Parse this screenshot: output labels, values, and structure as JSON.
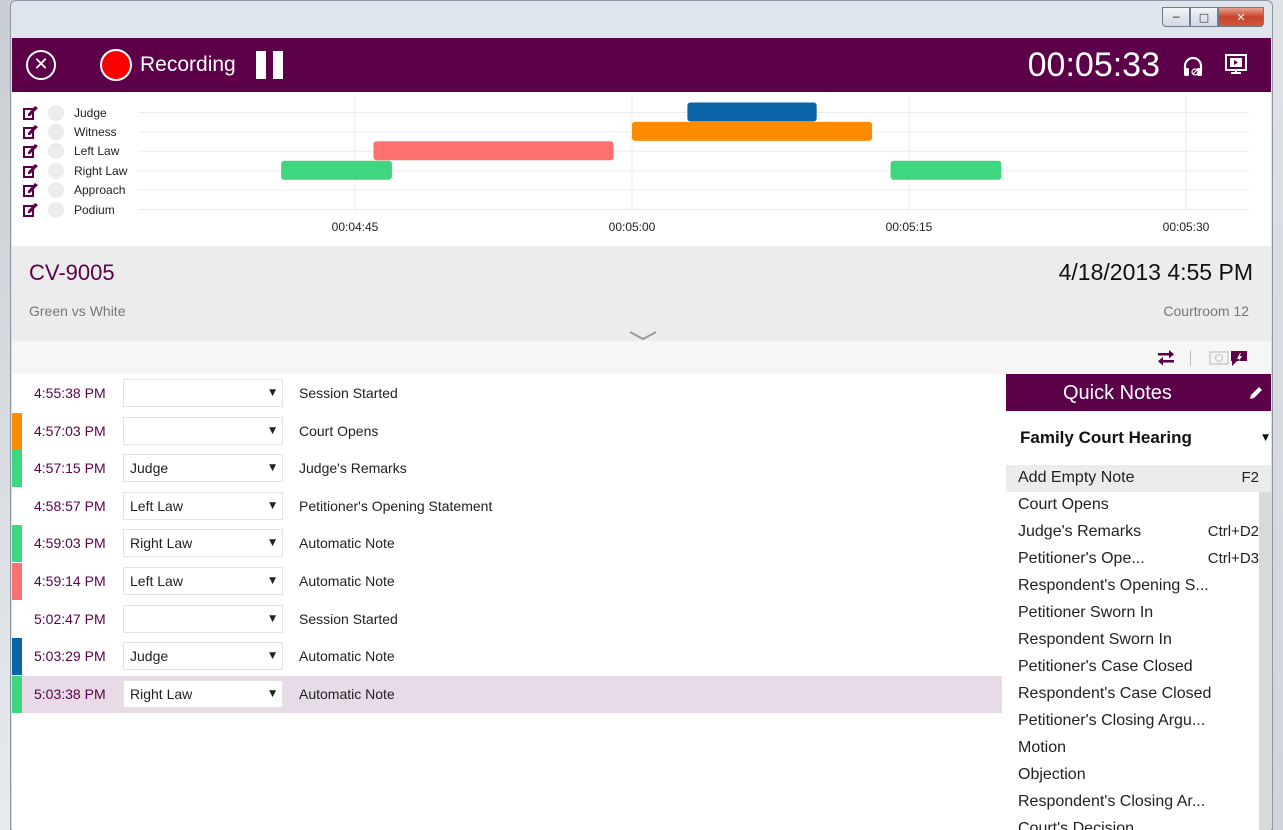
{
  "window": {
    "controls": {
      "minimize": "─",
      "maximize": "□",
      "close": "✕"
    }
  },
  "topbar": {
    "close_icon": "close-circle-icon",
    "recording_label": "Recording",
    "timer": "00:05:33",
    "colors": {
      "bar": "#5b0049",
      "record": "#ff0000"
    }
  },
  "timeline": {
    "tracks": [
      {
        "label": "Judge"
      },
      {
        "label": "Witness"
      },
      {
        "label": "Left Law"
      },
      {
        "label": "Right Law"
      },
      {
        "label": "Approach"
      },
      {
        "label": "Podium"
      }
    ],
    "ticks": [
      "00:04:45",
      "00:05:00",
      "00:05:15",
      "00:05:30"
    ],
    "segments": [
      {
        "track": "Judge",
        "start": "00:05:03",
        "end": "00:05:10",
        "color": "#0b64a8"
      },
      {
        "track": "Witness",
        "start": "00:05:00",
        "end": "00:05:13",
        "color": "#ff8c00"
      },
      {
        "track": "Left Law",
        "start": "00:04:46",
        "end": "00:04:59",
        "color": "#ff7070"
      },
      {
        "track": "Right Law",
        "start": "00:04:41",
        "end": "00:04:47",
        "color": "#3ed67e"
      },
      {
        "track": "Right Law",
        "start": "00:05:14",
        "end": "00:05:20",
        "color": "#3ed67e"
      }
    ]
  },
  "case": {
    "number": "CV-9005",
    "title": "Green vs White",
    "datetime": "4/18/2013 4:55 PM",
    "room": "Courtroom 12"
  },
  "notes": [
    {
      "time": "4:55:38 PM",
      "speaker": "",
      "text": "Session Started",
      "color": ""
    },
    {
      "time": "4:57:03 PM",
      "speaker": "",
      "text": "Court Opens",
      "color": "#ff8c00"
    },
    {
      "time": "4:57:15 PM",
      "speaker": "Judge",
      "text": "Judge's Remarks",
      "color": "#3ed67e"
    },
    {
      "time": "4:58:57 PM",
      "speaker": "Left Law",
      "text": "Petitioner's Opening Statement",
      "color": ""
    },
    {
      "time": "4:59:03 PM",
      "speaker": "Right Law",
      "text": "Automatic Note",
      "color": "#3ed67e"
    },
    {
      "time": "4:59:14 PM",
      "speaker": "Left Law",
      "text": "Automatic Note",
      "color": "#ff7070"
    },
    {
      "time": "5:02:47 PM",
      "speaker": "",
      "text": "Session Started",
      "color": ""
    },
    {
      "time": "5:03:29 PM",
      "speaker": "Judge",
      "text": "Automatic Note",
      "color": "#0b64a8"
    },
    {
      "time": "5:03:38 PM",
      "speaker": "Right Law",
      "text": "Automatic Note",
      "color": "#3ed67e"
    }
  ],
  "quick_notes": {
    "title": "Quick Notes",
    "template": "Family Court Hearing",
    "items": [
      {
        "label": "Add Empty Note",
        "key": "F2"
      },
      {
        "label": "Court Opens",
        "key": ""
      },
      {
        "label": "Judge's Remarks",
        "key": "Ctrl+D2"
      },
      {
        "label": "Petitioner's Ope...",
        "key": "Ctrl+D3"
      },
      {
        "label": "Respondent's Opening S...",
        "key": ""
      },
      {
        "label": "Petitioner Sworn In",
        "key": ""
      },
      {
        "label": "Respondent Sworn In",
        "key": ""
      },
      {
        "label": "Petitioner's Case Closed",
        "key": ""
      },
      {
        "label": "Respondent's Case Closed",
        "key": ""
      },
      {
        "label": "Petitioner's Closing Argu...",
        "key": ""
      },
      {
        "label": "Motion",
        "key": ""
      },
      {
        "label": "Objection",
        "key": ""
      },
      {
        "label": "Respondent's Closing Ar...",
        "key": ""
      },
      {
        "label": "Court's Decision",
        "key": ""
      }
    ]
  }
}
